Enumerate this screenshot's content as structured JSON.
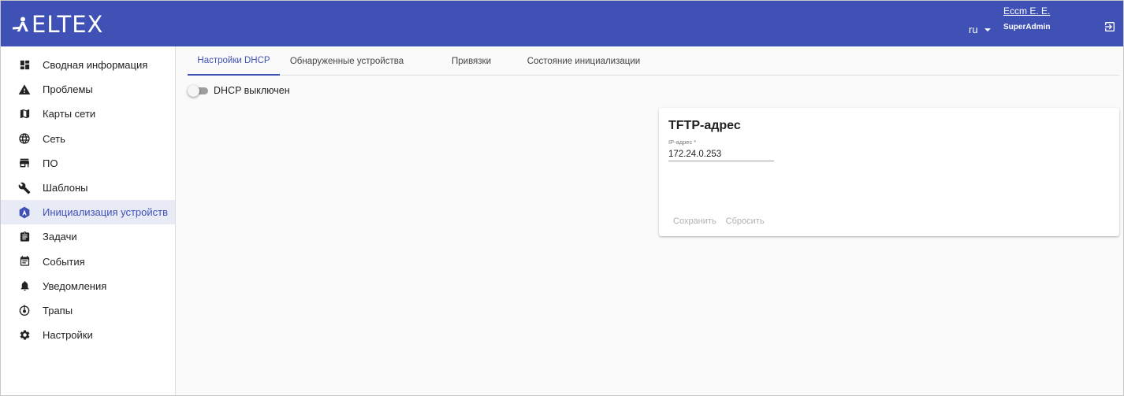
{
  "brand": {
    "name": "ELTEX",
    "header_color": "#3f51b5",
    "accent": "#3f51b5"
  },
  "header": {
    "language": "ru",
    "user_name": "Eccm E. E.",
    "user_role": "SuperAdmin",
    "logout_icon": "logout-icon"
  },
  "sidebar": {
    "items": [
      {
        "label": "Сводная информация",
        "icon": "dashboard-icon",
        "active": false
      },
      {
        "label": "Проблемы",
        "icon": "warning-icon",
        "active": false
      },
      {
        "label": "Карты сети",
        "icon": "map-icon",
        "active": false
      },
      {
        "label": "Сеть",
        "icon": "globe-icon",
        "active": false
      },
      {
        "label": "ПО",
        "icon": "store-icon",
        "active": false
      },
      {
        "label": "Шаблоны",
        "icon": "wrench-icon",
        "active": false
      },
      {
        "label": "Инициализация устройств",
        "icon": "device-init-icon",
        "active": true
      },
      {
        "label": "Задачи",
        "icon": "clipboard-icon",
        "active": false
      },
      {
        "label": "События",
        "icon": "event-note-icon",
        "active": false
      },
      {
        "label": "Уведомления",
        "icon": "bell-icon",
        "active": false
      },
      {
        "label": "Трапы",
        "icon": "trap-icon",
        "active": false
      },
      {
        "label": "Настройки",
        "icon": "gear-icon",
        "active": false
      }
    ]
  },
  "tabs": [
    {
      "label": "Настройки DHCP",
      "active": true
    },
    {
      "label": "Обнаруженные устройства",
      "active": false
    },
    {
      "label": "Привязки",
      "active": false
    },
    {
      "label": "Состояние инициализации",
      "active": false
    }
  ],
  "dhcp_toggle": {
    "label": "DHCP выключен",
    "enabled": false
  },
  "tftp_card": {
    "title": "TFTP-адрес",
    "field_label": "IP-адрес *",
    "field_value": "172.24.0.253",
    "save_label": "Сохранить",
    "reset_label": "Сбросить"
  }
}
